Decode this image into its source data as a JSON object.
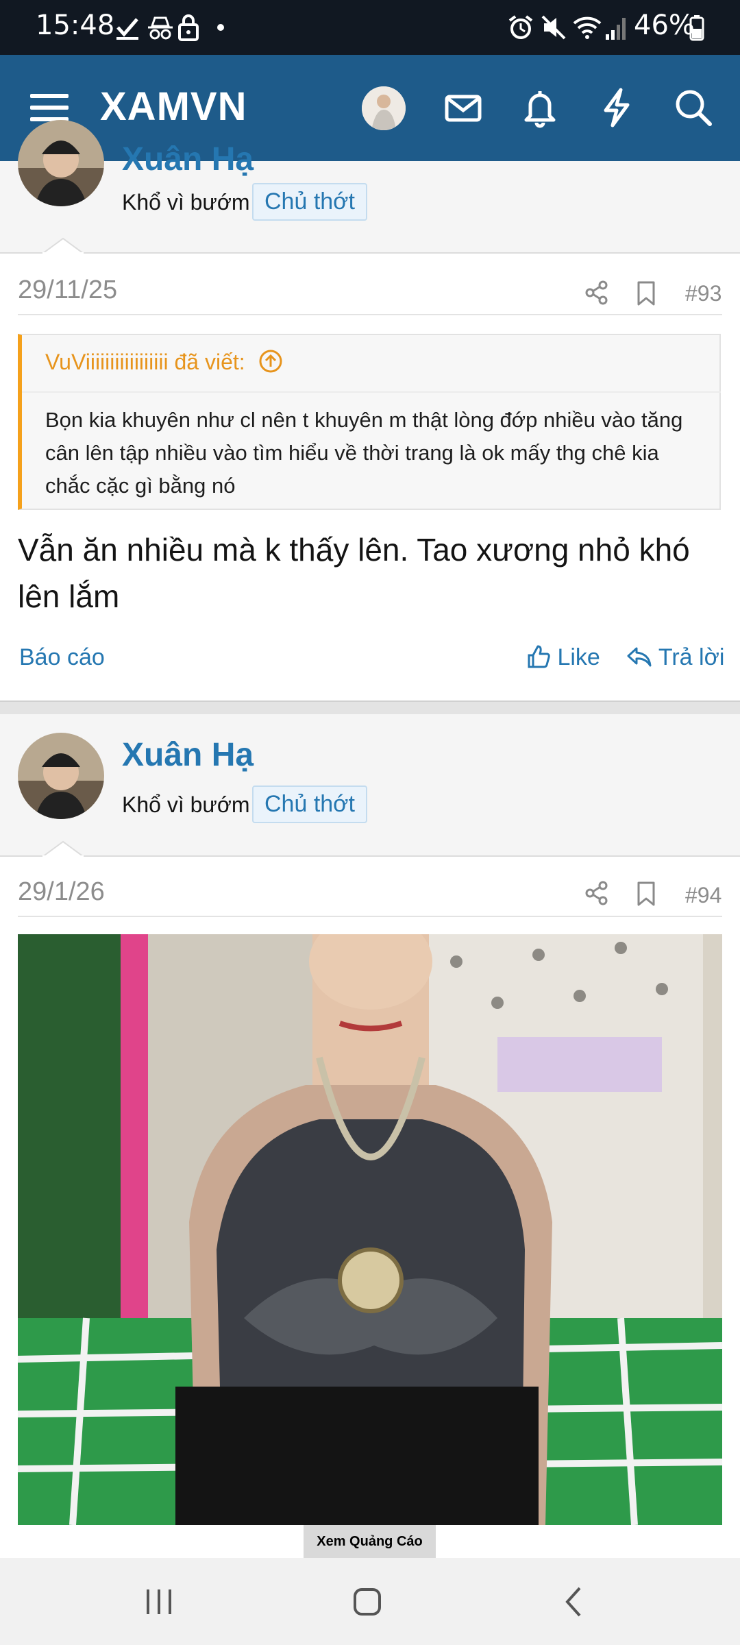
{
  "status_bar": {
    "time": "15:48",
    "battery": "46%"
  },
  "header": {
    "brand": "XAMVN",
    "icons": [
      "menu-icon",
      "avatar",
      "mail-icon",
      "bell-icon",
      "bolt-icon",
      "search-icon"
    ]
  },
  "post_93": {
    "username": "Xuân Hạ",
    "user_title": "Khổ vì bướm",
    "badge": "Chủ thớt",
    "date": "29/11/25",
    "number": "#93",
    "quote": {
      "author": "VuViiiiiiiiiiiiiiiii đã viết:",
      "text": "Bọn kia khuyên như cl nên t khuyên m thật lòng đớp nhiều vào tăng cân lên tập nhiều vào tìm hiểu về thời trang là ok mấy thg chê kia chắc cặc gì bằng nó"
    },
    "message": "Vẫn ăn nhiều mà k thấy lên. Tao xương nhỏ khó lên lắm",
    "report": "Báo cáo",
    "like": "Like",
    "reply": "Trả lời"
  },
  "post_94": {
    "username": "Xuân Hạ",
    "user_title": "Khổ vì bướm",
    "badge": "Chủ thớt",
    "date": "29/1/26",
    "number": "#94"
  },
  "ad": {
    "label": "Xem Quảng Cáo"
  },
  "colors": {
    "header_bg": "#1e5b8a",
    "link": "#2577b1",
    "quote_accent": "#f5a11b"
  }
}
